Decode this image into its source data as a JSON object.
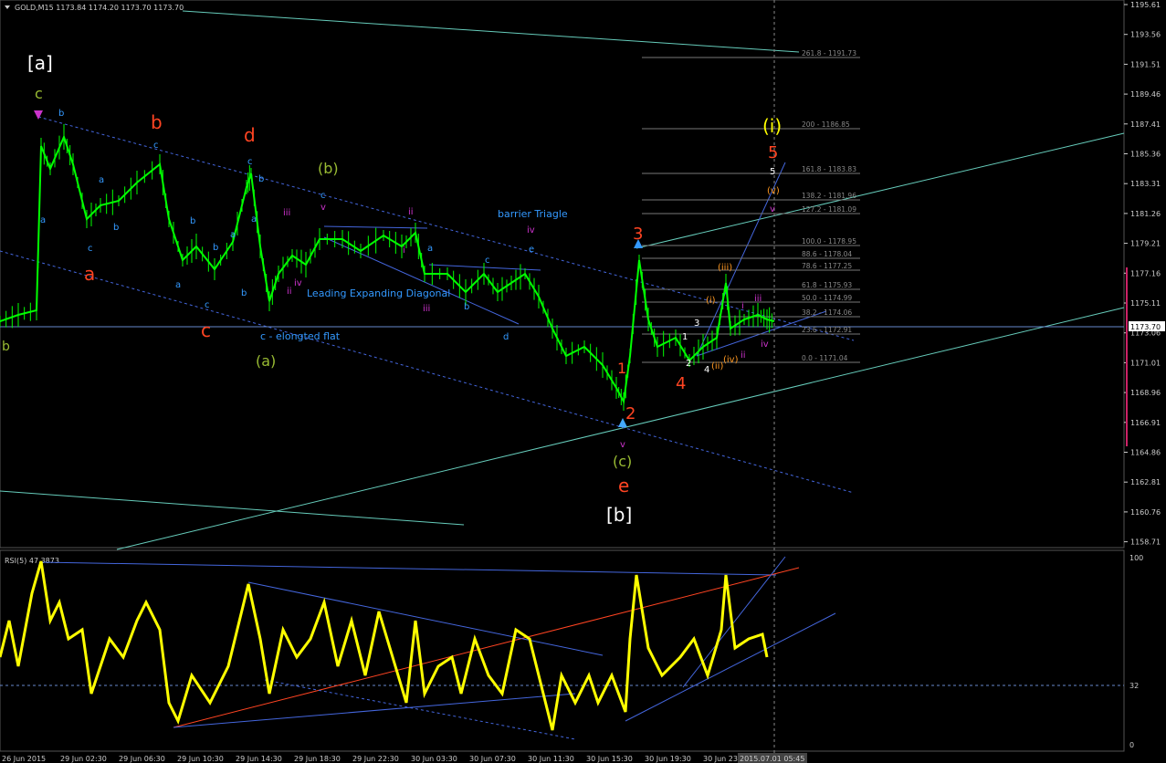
{
  "header": {
    "symbol_line": "GOLD,M15  1173.84 1174.20 1173.70 1173.70"
  },
  "price_axis": {
    "ticks": [
      "1195.61",
      "1193.56",
      "1191.51",
      "1189.46",
      "1187.41",
      "1185.36",
      "1183.31",
      "1181.26",
      "1179.21",
      "1177.16",
      "1175.11",
      "1173.06",
      "1171.01",
      "1168.96",
      "1166.91",
      "1164.86",
      "1162.81",
      "1160.76",
      "1158.71"
    ],
    "current_price": "1173.70"
  },
  "time_axis": {
    "ticks": [
      "26 Jun 2015",
      "29 Jun 02:30",
      "29 Jun 06:30",
      "29 Jun 10:30",
      "29 Jun 14:30",
      "29 Jun 18:30",
      "29 Jun 22:30",
      "30 Jun 03:30",
      "30 Jun 07:30",
      "30 Jun 11:30",
      "30 Jun 15:30",
      "30 Jun 19:30",
      "30 Jun 23:30"
    ],
    "cursor_time": "2015.07.01 05:45"
  },
  "fib_levels": [
    "261.8 - 1191.73",
    "200 - 1186.85",
    "161.8 - 1183.83",
    "138.2 - 1181.96",
    "127.2 - 1181.09",
    "100.0 - 1178.95",
    "88.6 - 1178.04",
    "78.6 - 1177.25",
    "61.8 - 1175.93",
    "50.0 - 1174.99",
    "38.2 - 1174.06",
    "23.6 - 1172.91",
    "0.0 - 1171.04"
  ],
  "annotations": {
    "wave_a_bracket": "[a]",
    "wave_b_bracket": "[b]",
    "c_green": "c",
    "b_left": "b",
    "a_red": "a",
    "b_red": "b",
    "c_red": "c",
    "d_red": "d",
    "e_red": "e",
    "wave_b_paren": "(b)",
    "wave_a_paren": "(a)",
    "wave_c_paren": "(c)",
    "wave_i_paren": "(i)",
    "elongated_flat": "c - elongted flat",
    "leading_diagonal": "Leading Expanding Diagonal",
    "barrier_triangle": "barrier Triagle",
    "num_1": "1",
    "num_2": "2",
    "num_3": "3",
    "num_4": "4",
    "num_5": "5"
  },
  "small_labels": {
    "b1": "b",
    "a1": "a",
    "c1": "c",
    "b2": "b",
    "a2": "a",
    "b3": "b",
    "c2": "c",
    "b4": "b",
    "a3": "a",
    "c3": "c",
    "a4": "a",
    "c4": "c",
    "b5": "b",
    "b6": "b",
    "a5": "a",
    "iii": "iii",
    "iv": "iv",
    "ii1": "ii",
    "v1": "v",
    "c5": "c",
    "ii2": "ii",
    "iii2": "iii",
    "a6": "a",
    "i1": "i",
    "b7": "b",
    "c6": "c",
    "d1": "d",
    "iv2": "iv",
    "e1": "e",
    "v2": "v",
    "w1": "1",
    "w2": "2",
    "w3": "3",
    "w4": "4",
    "wi": "(i)",
    "wii": "(ii)",
    "wiii": "(iii)",
    "wiv": "(iv)",
    "wv": "(v)",
    "w5": "5",
    "ri": "i",
    "rii": "ii",
    "riii": "iii",
    "riv": "iv",
    "rv": "v",
    "r1": "1"
  },
  "rsi": {
    "label": "RSI(5) 47.3873",
    "ticks": [
      "100",
      "32",
      "0"
    ]
  },
  "colors": {
    "background": "#000000",
    "price_line": "#00ff00",
    "rsi_line": "#ffff00",
    "channel": "#66ccbb",
    "wave_red": "#ff4422",
    "wave_green": "#99bb33",
    "small_blue": "#3399ff",
    "small_magenta": "#cc33cc",
    "orange": "#ff9922",
    "cursor": "#aaaaaa"
  }
}
